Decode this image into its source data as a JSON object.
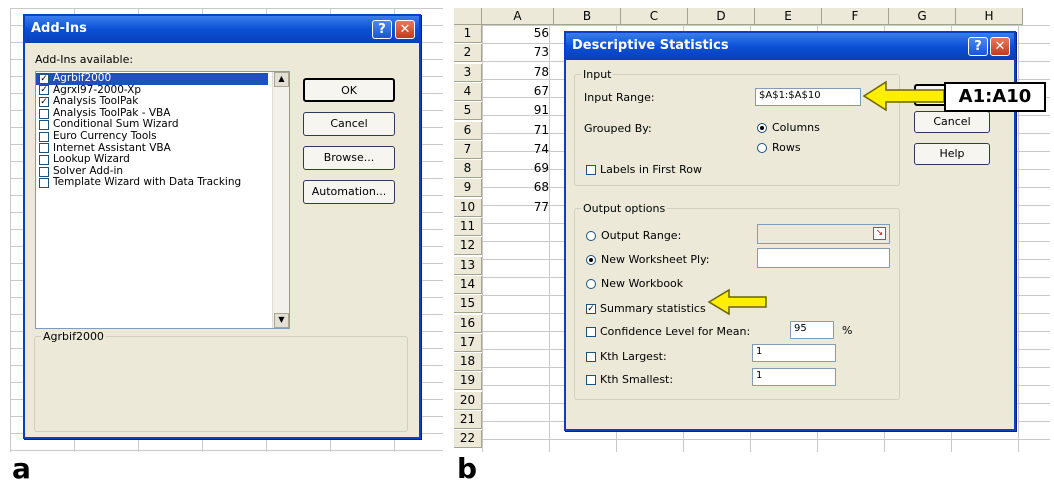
{
  "captions": {
    "a": "a",
    "b": "b"
  },
  "addins_dialog": {
    "title": "Add-Ins",
    "help_glyph": "?",
    "close_glyph": "✕",
    "available_label": "Add-Ins available:",
    "items": [
      {
        "label": "Agrbif2000",
        "checked": true,
        "selected": true
      },
      {
        "label": "Agrxl97-2000-Xp",
        "checked": true,
        "selected": false
      },
      {
        "label": "Analysis ToolPak",
        "checked": true,
        "selected": false
      },
      {
        "label": "Analysis ToolPak - VBA",
        "checked": false,
        "selected": false
      },
      {
        "label": "Conditional Sum Wizard",
        "checked": false,
        "selected": false
      },
      {
        "label": "Euro Currency Tools",
        "checked": false,
        "selected": false
      },
      {
        "label": "Internet Assistant VBA",
        "checked": false,
        "selected": false
      },
      {
        "label": "Lookup Wizard",
        "checked": false,
        "selected": false
      },
      {
        "label": "Solver Add-in",
        "checked": false,
        "selected": false
      },
      {
        "label": "Template Wizard with Data Tracking",
        "checked": false,
        "selected": false
      }
    ],
    "buttons": {
      "ok": "OK",
      "cancel": "Cancel",
      "browse": "Browse...",
      "automation": "Automation..."
    },
    "description_title": "Agrbif2000"
  },
  "spreadsheet": {
    "columns": [
      "A",
      "B",
      "C",
      "D",
      "E",
      "F",
      "G",
      "H"
    ],
    "rows": [
      "1",
      "2",
      "3",
      "4",
      "5",
      "6",
      "7",
      "8",
      "9",
      "10",
      "11",
      "12",
      "13",
      "14",
      "15",
      "16",
      "17",
      "18",
      "19",
      "20",
      "21",
      "22"
    ],
    "column_a_values": [
      "56",
      "73",
      "78",
      "67",
      "91",
      "71",
      "74",
      "69",
      "68",
      "77"
    ]
  },
  "descriptive_dialog": {
    "title": "Descriptive Statistics",
    "help_glyph": "?",
    "close_glyph": "✕",
    "input_group": "Input",
    "input_range_label": "Input Range:",
    "input_range_value": "$A$1:$A$10",
    "grouped_by_label": "Grouped By:",
    "columns_label": "Columns",
    "rows_label": "Rows",
    "labels_first_row": "Labels in First Row",
    "output_group": "Output options",
    "output_range_label": "Output Range:",
    "new_ply_label": "New Worksheet Ply:",
    "new_workbook_label": "New Workbook",
    "summary_stats_label": "Summary statistics",
    "confidence_label": "Confidence Level for Mean:",
    "confidence_value": "95",
    "percent": "%",
    "kth_largest_label": "Kth Largest:",
    "kth_largest_value": "1",
    "kth_smallest_label": "Kth Smallest:",
    "kth_smallest_value": "1",
    "buttons": {
      "cancel_partial": "Cancel",
      "help": "Help"
    },
    "callout_text": "A1:A10"
  },
  "colors": {
    "titlebar": "#0a50d6",
    "dialog_bg": "#ece9d8",
    "arrow": "#ffee00",
    "selection": "#2050b8"
  }
}
